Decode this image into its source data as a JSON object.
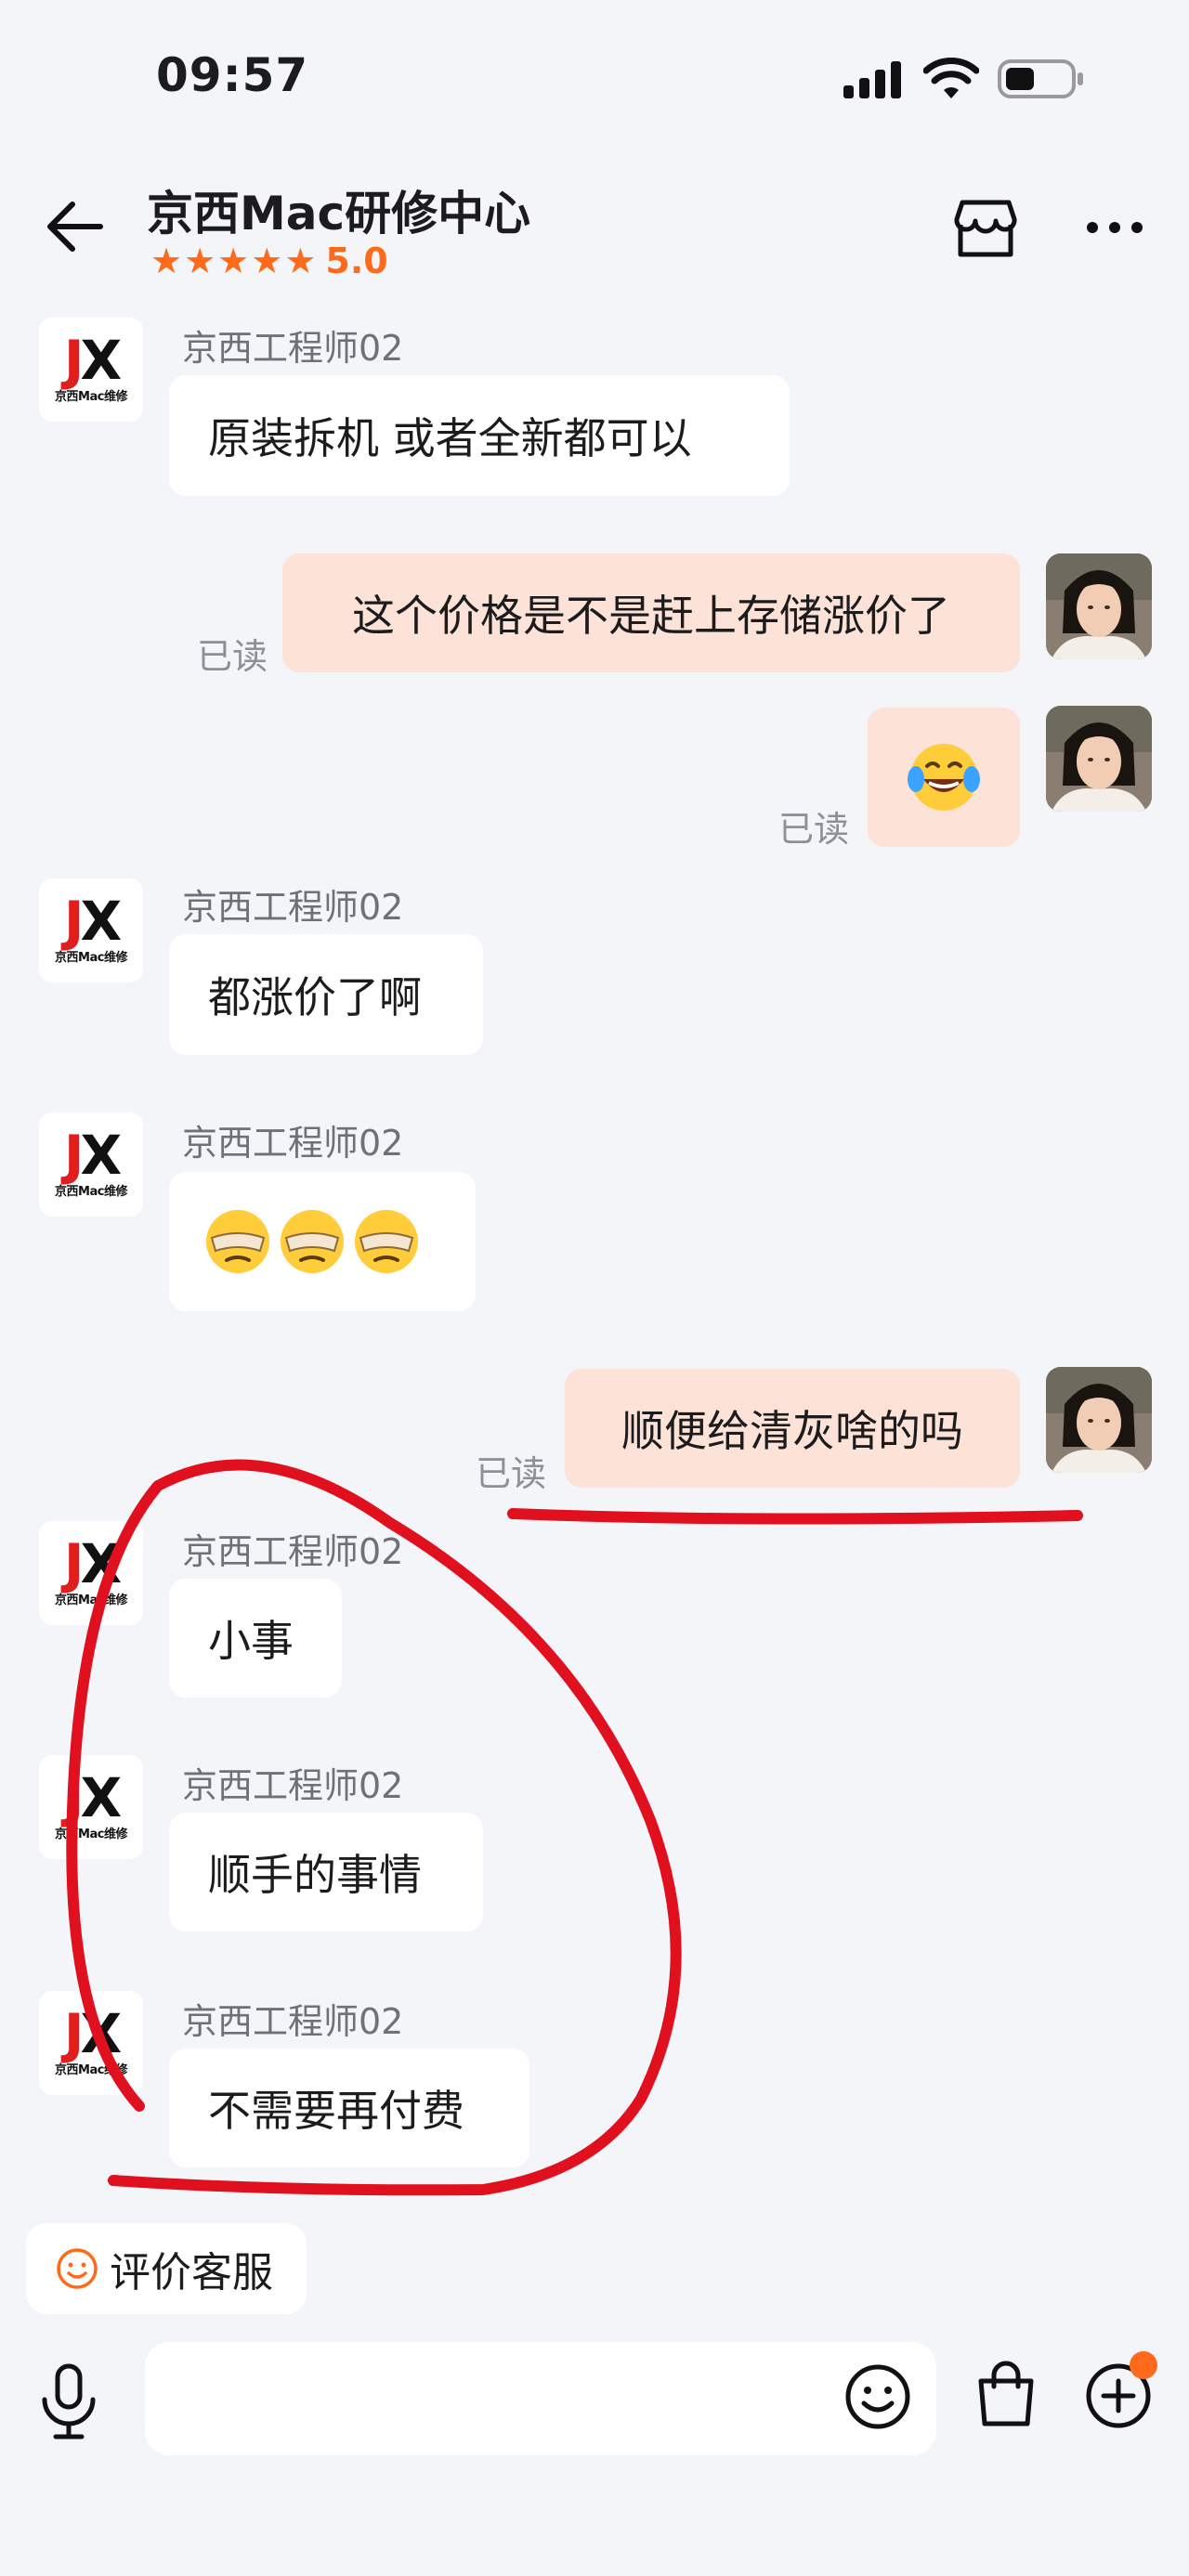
{
  "status_bar": {
    "time": "09:57"
  },
  "header": {
    "title": "京西Mac研修中心",
    "stars": [
      "★",
      "★",
      "★",
      "★",
      "★"
    ],
    "rating": "5.0"
  },
  "shop_avatar": {
    "logo_text": "JX",
    "logo_sub": "京西Mac维修"
  },
  "messages": [
    {
      "side": "in",
      "sender": "京西工程师02",
      "text": "原装拆机  或者全新都可以"
    },
    {
      "side": "out",
      "read": "已读",
      "text": "这个价格是不是赶上存储涨价了"
    },
    {
      "side": "out",
      "read": "已读",
      "emoji": "laughing-tears"
    },
    {
      "side": "in",
      "sender": "京西工程师02",
      "text": "都涨价了啊"
    },
    {
      "side": "in",
      "sender": "京西工程师02",
      "emoji": "facepalm x3"
    },
    {
      "side": "out",
      "read": "已读",
      "text": "顺便给清灰啥的吗"
    },
    {
      "side": "in",
      "sender": "京西工程师02",
      "text": "小事"
    },
    {
      "side": "in",
      "sender": "京西工程师02",
      "text": "顺手的事情"
    },
    {
      "side": "in",
      "sender": "京西工程师02",
      "text": "不需要再付费"
    }
  ],
  "rate_service": {
    "label": "评价客服"
  },
  "colors": {
    "accent": "#ff6a1a",
    "outgoing_bubble": "#fde3d7",
    "annotation": "#e0101e"
  }
}
